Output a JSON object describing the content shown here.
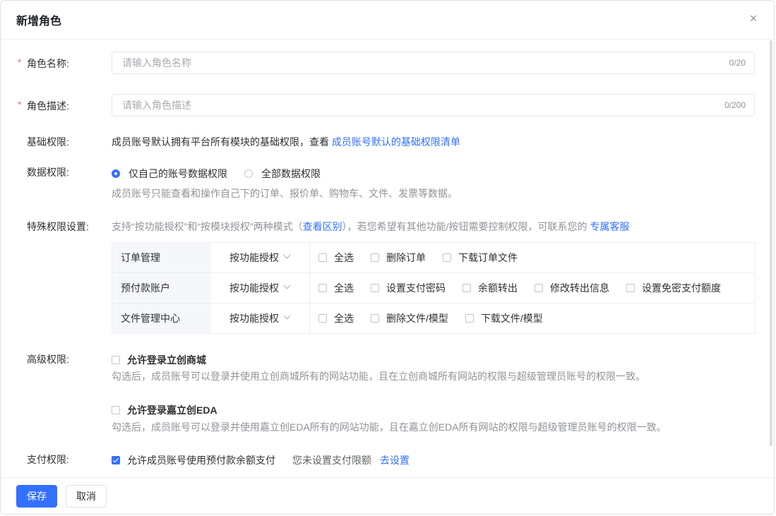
{
  "dialog": {
    "title": "新增角色",
    "close": "×"
  },
  "form": {
    "required_mark": "*",
    "role_name": {
      "label": "角色名称:",
      "placeholder": "请输入角色名称",
      "value": "",
      "count": "0/20"
    },
    "role_desc": {
      "label": "角色描述:",
      "placeholder": "请输入角色描述",
      "value": "",
      "count": "0/200"
    },
    "basic_perm": {
      "label": "基础权限:",
      "text": "成员账号默认拥有平台所有模块的基础权限，查看",
      "link": "成员账号默认的基础权限清单"
    },
    "data_perm": {
      "label": "数据权限:",
      "options": [
        "仅自己的账号数据权限",
        "全部数据权限"
      ],
      "selected": "仅自己的账号数据权限",
      "hint": "成员账号只能查看和操作自己下的订单、报价单、购物车、文件、发票等数据。"
    },
    "special_perm": {
      "label": "特殊权限设置:",
      "text_before": "支持“按功能授权”和“按模块授权”两种模式（",
      "link1": "查看区别",
      "text_mid": "），若您希望有其他功能/按钮需要控制权限，可联系您的",
      "link2": "专属客服",
      "rows": [
        {
          "module": "订单管理",
          "mode": "按功能授权",
          "options": [
            "全选",
            "删除订单",
            "下载订单文件"
          ]
        },
        {
          "module": "预付款账户",
          "mode": "按功能授权",
          "options": [
            "全选",
            "设置支付密码",
            "余额转出",
            "修改转出信息",
            "设置免密支付额度"
          ]
        },
        {
          "module": "文件管理中心",
          "mode": "按功能授权",
          "options": [
            "全选",
            "删除文件/模型",
            "下载文件/模型"
          ]
        }
      ]
    },
    "advanced_perm": {
      "label": "高级权限:",
      "items": [
        {
          "label": "允许登录立创商城",
          "checked": false,
          "hint": "勾选后，成员账号可以登录并使用立创商城所有的网站功能，且在立创商城所有网站的权限与超级管理员账号的权限一致。"
        },
        {
          "label": "允许登录嘉立创EDA",
          "checked": false,
          "hint": "勾选后，成员账号可以登录并使用嘉立创EDA所有的网站功能，且在嘉立创EDA所有网站的权限与超级管理员账号的权限一致。"
        }
      ]
    },
    "pay_perm": {
      "label": "支付权限:",
      "checkbox_label": "允许成员账号使用预付款余额支付",
      "checked": true,
      "note": "您未设置支付限额",
      "link": "去设置"
    }
  },
  "footer": {
    "save": "保存",
    "cancel": "取消"
  },
  "colors": {
    "primary": "#3370ff",
    "required": "#f56c6c",
    "hint": "#909399"
  }
}
